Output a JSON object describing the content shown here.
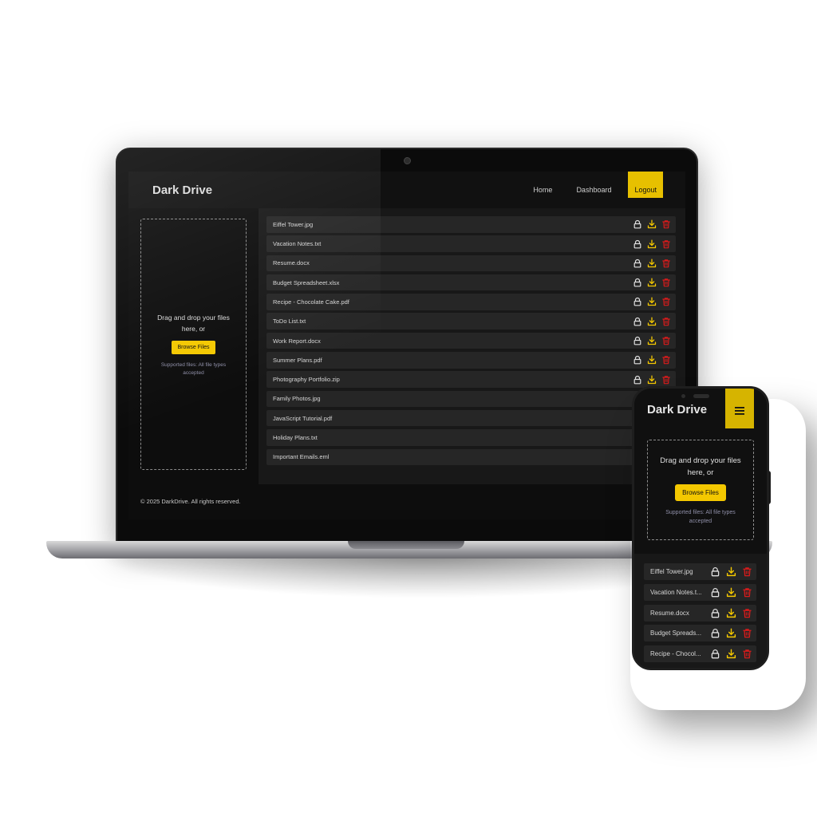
{
  "colors": {
    "accent": "#f4c800",
    "download_icon": "#f4c800",
    "delete_icon": "#d81b1b",
    "lock_icon": "#e0e0e0",
    "background": "#0d0d0d",
    "panel": "#181818",
    "row": "#262626"
  },
  "laptop": {
    "brand": "Dark Drive",
    "nav": {
      "home": "Home",
      "dashboard": "Dashboard",
      "logout": "Logout"
    },
    "upload": {
      "title": "Drag and drop your files here, or",
      "browse_label": "Browse Files",
      "supported": "Supported files: All file types accepted"
    },
    "files": [
      {
        "name": "Eiffel Tower.jpg"
      },
      {
        "name": "Vacation Notes.txt"
      },
      {
        "name": "Resume.docx"
      },
      {
        "name": "Budget Spreadsheet.xlsx"
      },
      {
        "name": "Recipe - Chocolate Cake.pdf"
      },
      {
        "name": "ToDo List.txt"
      },
      {
        "name": "Work Report.docx"
      },
      {
        "name": "Summer Plans.pdf"
      },
      {
        "name": "Photography Portfolio.zip"
      },
      {
        "name": "Family Photos.jpg"
      },
      {
        "name": "JavaScript Tutorial.pdf"
      },
      {
        "name": "Holiday Plans.txt"
      },
      {
        "name": "Important Emails.eml"
      }
    ],
    "file_icons": [
      "lock-icon",
      "download-icon",
      "trash-icon"
    ],
    "footer": "© 2025 DarkDrive. All rights reserved."
  },
  "phone": {
    "brand": "Dark Drive",
    "menu_icon": "hamburger-menu-icon",
    "upload": {
      "title": "Drag and drop your files here, or",
      "browse_label": "Browse Files",
      "supported": "Supported files: All file types accepted"
    },
    "files": [
      {
        "name": "Eiffel Tower.jpg"
      },
      {
        "name": "Vacation Notes.t..."
      },
      {
        "name": "Resume.docx"
      },
      {
        "name": "Budget Spreads..."
      },
      {
        "name": "Recipe - Chocol..."
      }
    ]
  }
}
